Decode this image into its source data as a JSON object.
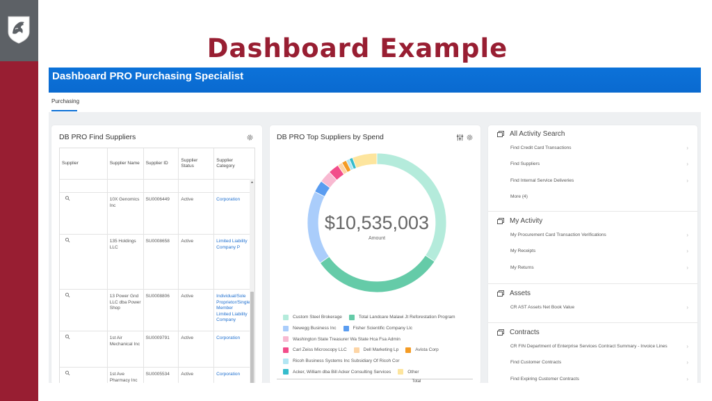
{
  "slide": {
    "title": "Dashboard Example",
    "logo_icon": "cougar-shield-logo-icon"
  },
  "app": {
    "header_title": "Dashboard PRO Purchasing Specialist",
    "tabs": [
      {
        "label": "Purchasing",
        "active": true
      }
    ]
  },
  "find_suppliers": {
    "title": "DB PRO Find Suppliers",
    "settings_icon": "gear-icon",
    "columns": [
      "Supplier",
      "Supplier Name",
      "Supplier ID",
      "Supplier Status",
      "Supplier Category"
    ],
    "rows": [
      {
        "name": "10X Genomics Inc",
        "id": "SU0006449",
        "status": "Active",
        "category": "Corporation"
      },
      {
        "name": "135 Holdings LLC",
        "id": "SU0008658",
        "status": "Active",
        "category": "Limited Liability Company P"
      },
      {
        "name": "13 Power Gnd LLC dba Power Shop",
        "id": "SU0008806",
        "status": "Active",
        "category": "Individual/Sole Proprietor/Single-Member Limited Liability Company"
      },
      {
        "name": "1st Air Mechanical Inc",
        "id": "SU0009791",
        "status": "Active",
        "category": "Corporation"
      },
      {
        "name": "1st Ave Pharmacy Inc",
        "id": "SU0005534",
        "status": "Active",
        "category": "Corporation"
      }
    ]
  },
  "top_suppliers": {
    "title": "DB PRO Top Suppliers by Spend",
    "filter_icon": "sliders-icon",
    "settings_icon": "gear-icon",
    "center_value": "$10,535,003",
    "center_label": "Amount",
    "total_label": "Total"
  },
  "chart_data": {
    "type": "pie",
    "title": "DB PRO Top Suppliers by Spend",
    "total": 10535003,
    "total_label": "Amount",
    "legend_position": "bottom",
    "unit": "percent of total (estimated from arc lengths)",
    "slices": [
      {
        "label": "Custom Steel Brokerage",
        "value": 34.4,
        "color": "#b4ebdb"
      },
      {
        "label": "Total Landcare Malawi Jt Reforestation Program",
        "value": 30.8,
        "color": "#65cba8"
      },
      {
        "label": "Newegg Business Inc",
        "value": 17.2,
        "color": "#aacdfb"
      },
      {
        "label": "Fisher Scientific Company Llc",
        "value": 2.8,
        "color": "#5a9cf0"
      },
      {
        "label": "Washington State Treasurer Wa State Hca Fsa Admin",
        "value": 2.8,
        "color": "#f8b9d1"
      },
      {
        "label": "Carl Zeiss Microscopy LLC",
        "value": 2.5,
        "color": "#f24d8a"
      },
      {
        "label": "Dell Marketing Lp",
        "value": 1.1,
        "color": "#fdd5a6"
      },
      {
        "label": "Avista Corp",
        "value": 1.1,
        "color": "#f49b24"
      },
      {
        "label": "Ricoh Business Systems Inc Subsidiary Of Ricoh Cor",
        "value": 0.8,
        "color": "#b2e6f3"
      },
      {
        "label": "Acker, William dba Bill Acker Consulting Services",
        "value": 0.8,
        "color": "#35bccc"
      },
      {
        "label": "Other",
        "value": 5.7,
        "color": "#fde59e"
      }
    ]
  },
  "legend_rows": [
    [
      0,
      1
    ],
    [
      2,
      3
    ],
    [
      4
    ],
    [
      5,
      6,
      7
    ],
    [
      8
    ],
    [
      9,
      10
    ]
  ],
  "right_panel": {
    "sections": [
      {
        "title": "All Activity Search",
        "icon": "windows-stack-icon",
        "items": [
          {
            "label": "Find Credit Card Transactions",
            "chevron": true
          },
          {
            "label": "Find Suppliers",
            "chevron": true
          },
          {
            "label": "Find Internal Service Deliveries",
            "chevron": true
          },
          {
            "label": "More (4)",
            "chevron": false
          }
        ]
      },
      {
        "title": "My Activity",
        "icon": "windows-stack-icon",
        "items": [
          {
            "label": "My Procurement Card Transaction Verifications",
            "chevron": true
          },
          {
            "label": "My Receipts",
            "chevron": true
          },
          {
            "label": "My Returns",
            "chevron": true
          }
        ]
      },
      {
        "title": "Assets",
        "icon": "windows-stack-icon",
        "items": [
          {
            "label": "CR AST Assets Net Book Value",
            "chevron": true
          }
        ]
      },
      {
        "title": "Contracts",
        "icon": "windows-stack-icon",
        "items": [
          {
            "label": "CR FIN Department of Enterprise Services Contract Summary - Invoice Lines",
            "chevron": true
          },
          {
            "label": "Find Customer Contracts",
            "chevron": true
          },
          {
            "label": "Find Expiring Customer Contracts",
            "chevron": true
          }
        ]
      }
    ]
  }
}
